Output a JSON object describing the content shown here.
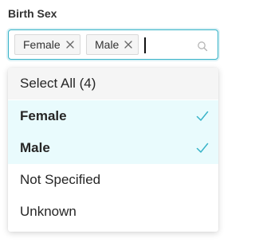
{
  "field": {
    "label": "Birth Sex"
  },
  "select": {
    "tags": [
      {
        "label": "Female",
        "icon": "close-icon"
      },
      {
        "label": "Male",
        "icon": "close-icon"
      }
    ],
    "search_icon": "search-icon"
  },
  "dropdown": {
    "select_all_label": "Select All (4)",
    "options": [
      {
        "label": "Female",
        "selected": true,
        "icon": "check-icon"
      },
      {
        "label": "Male",
        "selected": true,
        "icon": "check-icon"
      },
      {
        "label": "Not Specified",
        "selected": false
      },
      {
        "label": "Unknown",
        "selected": false
      }
    ]
  },
  "colors": {
    "accent": "#38b3c8",
    "selected_bg": "#e9fbfd",
    "hover_bg": "#f5f5f5"
  }
}
